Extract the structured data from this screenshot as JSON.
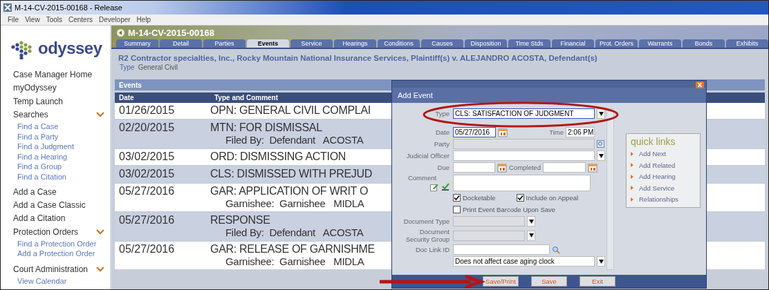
{
  "window": {
    "title": "M-14-CV-2015-00168 - Release"
  },
  "menu": [
    "File",
    "View",
    "Tools",
    "Centers",
    "Developer",
    "Help"
  ],
  "logo": {
    "text": "odyssey"
  },
  "sidebar": {
    "items": [
      {
        "label": "Case Manager Home",
        "kind": "link"
      },
      {
        "label": "myOdyssey",
        "kind": "link"
      },
      {
        "label": "Temp Launch",
        "kind": "link"
      },
      {
        "label": "Searches",
        "kind": "section",
        "expanded": true,
        "children": [
          {
            "label": "Find a Case"
          },
          {
            "label": "Find a Party"
          },
          {
            "label": "Find a Judgment"
          },
          {
            "label": "Find a Hearing"
          },
          {
            "label": "Find a Group"
          },
          {
            "label": "Find a Citation"
          }
        ]
      },
      {
        "label": "Add a Case",
        "kind": "link"
      },
      {
        "label": "Add a Case Classic",
        "kind": "link"
      },
      {
        "label": "Add a Citation",
        "kind": "link"
      },
      {
        "label": "Protection Orders",
        "kind": "section",
        "expanded": true,
        "children": [
          {
            "label": "Find a Protection Order"
          },
          {
            "label": "Add a Protection Order"
          }
        ]
      },
      {
        "label": "Court Administration",
        "kind": "section",
        "expanded": true,
        "children": [
          {
            "label": "View Calendar"
          }
        ]
      }
    ]
  },
  "case": {
    "number": "M-14-CV-2015-00168",
    "caption": "R2 Contractor specialties, Inc., Rocky Mountain National Insurance Services, Plaintiff(s) v. ALEJANDRO ACOSTA, Defendant(s)",
    "type_label": "Type",
    "type_value": "General Civil"
  },
  "tabs": [
    {
      "label": "Summary",
      "selected": false
    },
    {
      "label": "Detail",
      "selected": false
    },
    {
      "label": "Parties",
      "selected": false
    },
    {
      "label": "Events",
      "selected": true
    },
    {
      "label": "Service",
      "selected": false
    },
    {
      "label": "Hearings",
      "selected": false
    },
    {
      "label": "Conditions",
      "selected": false
    },
    {
      "label": "Causes",
      "selected": false
    },
    {
      "label": "Disposition",
      "selected": false
    },
    {
      "label": "Time Stds",
      "selected": false
    },
    {
      "label": "Financial",
      "selected": false
    },
    {
      "label": "Prot. Orders",
      "selected": false
    },
    {
      "label": "Warrants",
      "selected": false
    },
    {
      "label": "Bonds",
      "selected": false
    },
    {
      "label": "Exhibits",
      "selected": false
    }
  ],
  "events": {
    "title": "Events",
    "columns": [
      "Date",
      "Type and Comment"
    ],
    "rows": [
      {
        "date": "01/26/2015",
        "type": "OPN: GENERAL CIVIL COMPLAI"
      },
      {
        "date": "02/20/2015",
        "type": "MTN: FOR DISMISSAL",
        "comment": "Filed By:  Defendant   ACOSTA"
      },
      {
        "date": "03/02/2015",
        "type": "ORD: DISMISSING ACTION"
      },
      {
        "date": "03/02/2015",
        "type": "CLS: DISMISSED WITH PREJUD"
      },
      {
        "date": "05/27/2016",
        "type": "GAR: APPLICATION OF WRIT O",
        "comment": "Garnishee:  Garnishee   MIDLA"
      },
      {
        "date": "05/27/2016",
        "type": "RESPONSE",
        "comment": "Filed By:  Defendant   ACOSTA"
      },
      {
        "date": "05/27/2016",
        "type": "GAR: RELEASE OF GARNISHME",
        "comment": "Garnishee:  Garnishee   MIDLA"
      }
    ]
  },
  "dialog": {
    "title": "Add Event",
    "type": {
      "label": "Type",
      "value": "CLS: SATISFACTION OF JUDGMENT"
    },
    "date": {
      "label": "Date",
      "value": "05/27/2016"
    },
    "time": {
      "label": "Time",
      "value": "2:06 PM"
    },
    "party": {
      "label": "Party",
      "disabled": true
    },
    "judicial_officer": {
      "label": "Judicial Officer"
    },
    "due": {
      "label": "Due"
    },
    "completed": {
      "label": "Completed"
    },
    "comment": {
      "label": "Comment"
    },
    "checks": [
      {
        "label": "Docketable",
        "checked": true
      },
      {
        "label": "Include on Appeal",
        "checked": true
      },
      {
        "label": "Print Event Barcode Upon Save",
        "checked": false
      }
    ],
    "document_type": {
      "label": "Document Type",
      "disabled": true
    },
    "security_group": {
      "label": "Document Security Group",
      "disabled": true
    },
    "doc_link_id": {
      "label": "Doc Link ID"
    },
    "aging": {
      "value": "Does not affect case aging clock"
    },
    "quick_links": {
      "title": "quick links",
      "items": [
        "Add Next",
        "Add Related",
        "Add Hearing",
        "Add Service",
        "Relationships"
      ]
    },
    "buttons": [
      "Save/Print",
      "Save",
      "Exit"
    ]
  }
}
